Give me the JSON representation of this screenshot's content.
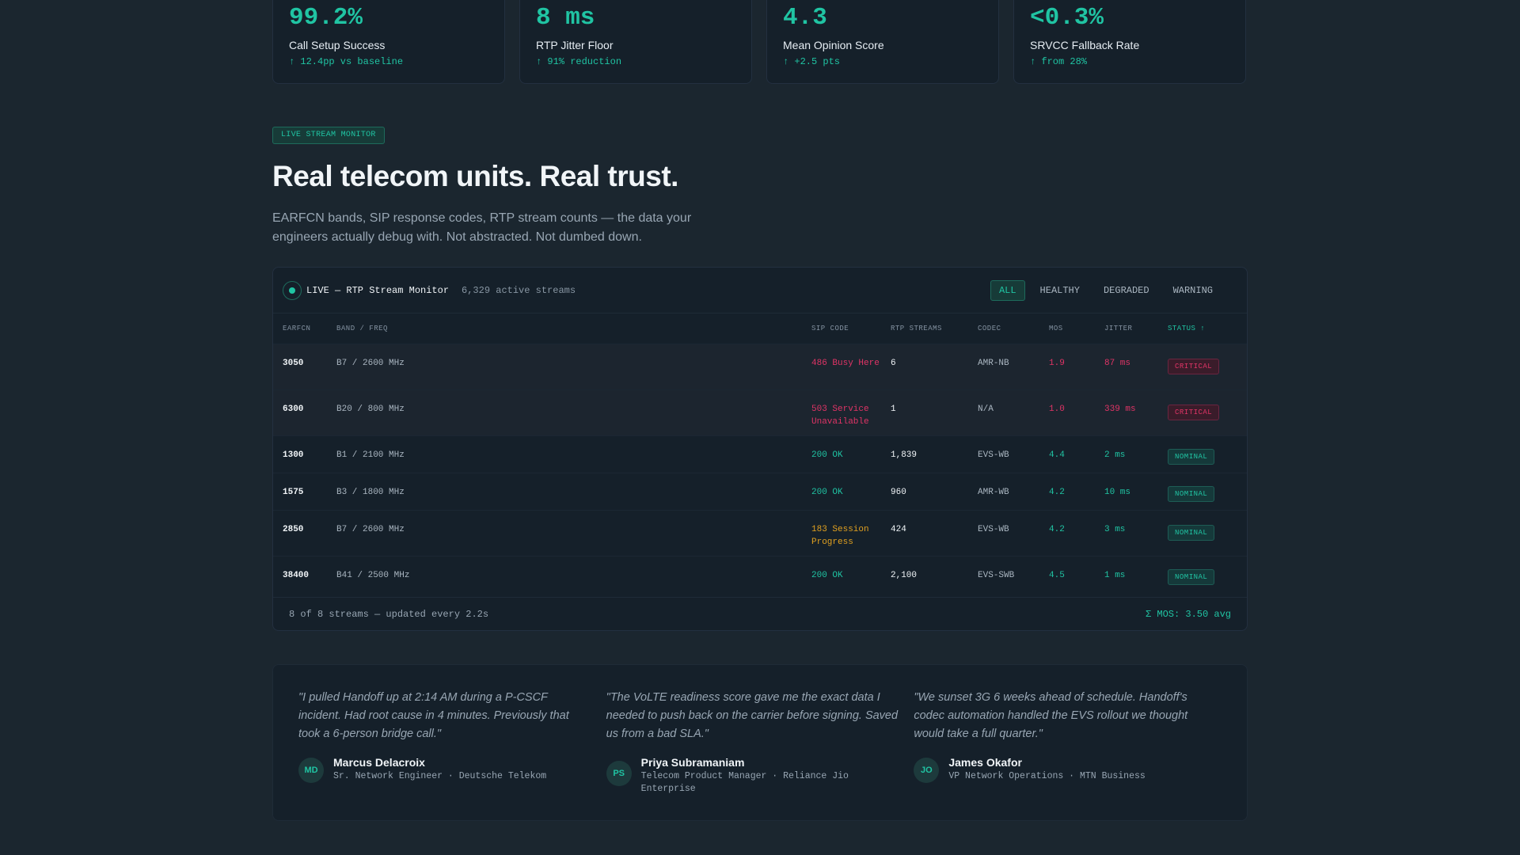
{
  "stats": [
    {
      "value": "99.2%",
      "label": "Call Setup Success",
      "delta": "↑ 12.4pp vs baseline"
    },
    {
      "value": "8 ms",
      "label": "RTP Jitter Floor",
      "delta": "↑ 91% reduction"
    },
    {
      "value": "4.3",
      "label": "Mean Opinion Score",
      "delta": "↑ +2.5 pts"
    },
    {
      "value": "<0.3%",
      "label": "SRVCC Fallback Rate",
      "delta": "↑ from 28%"
    }
  ],
  "hero": {
    "badge": "LIVE STREAM MONITOR",
    "title": "Real telecom units. Real trust.",
    "subtitle": "EARFCN bands, SIP response codes, RTP stream counts — the data your engineers actually debug with. Not abstracted. Not dumbed down."
  },
  "monitor": {
    "title": "LIVE — RTP Stream Monitor",
    "count": "6,329 active streams",
    "filters": [
      "ALL",
      "HEALTHY",
      "DEGRADED",
      "WARNING"
    ],
    "active_filter": "ALL",
    "columns": [
      "EARFCN",
      "BAND / FREQ",
      "SIP CODE",
      "RTP STREAMS",
      "CODEC",
      "MOS",
      "JITTER",
      "STATUS ↑"
    ],
    "rows": [
      {
        "earfcn": "3050",
        "band": "B7 / 2600 MHz",
        "sip": "486 Busy Here",
        "streams": "6",
        "codec": "AMR-NB",
        "mos": "1.9",
        "jitter": "87 ms",
        "status": "CRITICAL"
      },
      {
        "earfcn": "6300",
        "band": "B20 / 800 MHz",
        "sip": "503 Service Unavailable",
        "streams": "1",
        "codec": "N/A",
        "mos": "1.0",
        "jitter": "339 ms",
        "status": "CRITICAL"
      },
      {
        "earfcn": "1300",
        "band": "B1 / 2100 MHz",
        "sip": "200 OK",
        "streams": "1,839",
        "codec": "EVS-WB",
        "mos": "4.4",
        "jitter": "2 ms",
        "status": "NOMINAL"
      },
      {
        "earfcn": "1575",
        "band": "B3 / 1800 MHz",
        "sip": "200 OK",
        "streams": "960",
        "codec": "AMR-WB",
        "mos": "4.2",
        "jitter": "10 ms",
        "status": "NOMINAL"
      },
      {
        "earfcn": "2850",
        "band": "B7 / 2600 MHz",
        "sip": "183 Session Progress",
        "streams": "424",
        "codec": "EVS-WB",
        "mos": "4.2",
        "jitter": "3 ms",
        "status": "NOMINAL"
      },
      {
        "earfcn": "38400",
        "band": "B41 / 2500 MHz",
        "sip": "200 OK",
        "streams": "2,100",
        "codec": "EVS-SWB",
        "mos": "4.5",
        "jitter": "1 ms",
        "status": "NOMINAL"
      }
    ],
    "footer_left": "8 of 8 streams — updated every 2.2s",
    "footer_right": "Σ MOS: 3.50 avg"
  },
  "testimonials": [
    {
      "quote": "\"I pulled Handoff up at 2:14 AM during a P-CSCF incident. Had root cause in 4 minutes. Previously that took a 6-person bridge call.\"",
      "initials": "MD",
      "name": "Marcus Delacroix",
      "role": "Sr. Network Engineer · Deutsche Telekom"
    },
    {
      "quote": "\"The VoLTE readiness score gave me the exact data I needed to push back on the carrier before signing. Saved us from a bad SLA.\"",
      "initials": "PS",
      "name": "Priya Subramaniam",
      "role": "Telecom Product Manager · Reliance Jio Enterprise"
    },
    {
      "quote": "\"We sunset 3G 6 weeks ahead of schedule. Handoff's codec automation handled the EVS rollout we thought would take a full quarter.\"",
      "initials": "JO",
      "name": "James Okafor",
      "role": "VP Network Operations · MTN Business"
    }
  ],
  "colors": {
    "accent": "#20c4a3",
    "critical": "#e03466",
    "warning": "#e0a020",
    "background": "#1b262f"
  }
}
